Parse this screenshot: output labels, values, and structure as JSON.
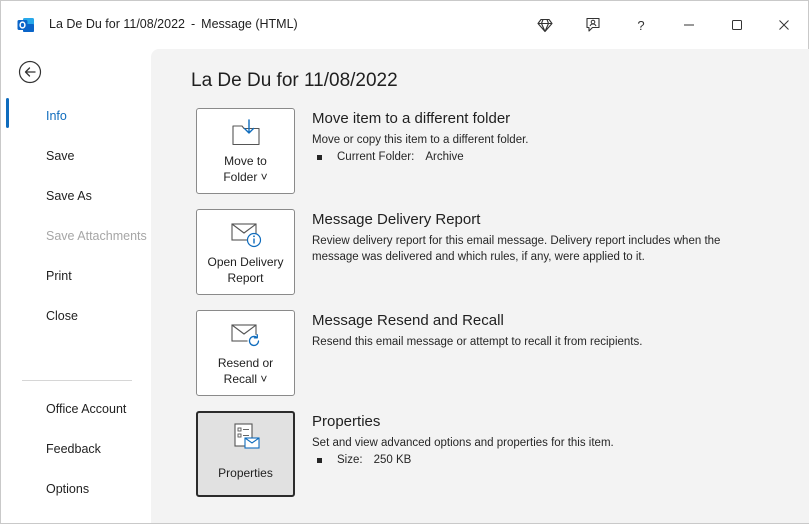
{
  "window": {
    "title_subject": "La De Du for 11/08/2022",
    "title_separator": "-",
    "title_kind": "Message (HTML)",
    "controls": [
      "diamond-icon",
      "feedback-icon",
      "help-icon",
      "minimize-icon",
      "maximize-icon",
      "close-icon"
    ],
    "help_label": "?"
  },
  "sidebar": {
    "items": [
      {
        "label": "Info",
        "state": "active"
      },
      {
        "label": "Save",
        "state": "normal"
      },
      {
        "label": "Save As",
        "state": "normal"
      },
      {
        "label": "Save Attachments",
        "state": "disabled"
      },
      {
        "label": "Print",
        "state": "normal"
      },
      {
        "label": "Close",
        "state": "normal"
      }
    ],
    "bottom_items": [
      {
        "label": "Office Account"
      },
      {
        "label": "Feedback"
      },
      {
        "label": "Options"
      }
    ]
  },
  "main": {
    "title": "La De Du for 11/08/2022",
    "sections": [
      {
        "button_line1": "Move to",
        "button_line2": "Folder ˅",
        "title": "Move item to a different folder",
        "description": "Move or copy this item to a different folder.",
        "detail_label": "Current Folder:",
        "detail_value": "Archive"
      },
      {
        "button_line1": "Open Delivery",
        "button_line2": "Report",
        "title": "Message Delivery Report",
        "description": "Review delivery report for this email message. Delivery report includes when the message was delivered and which rules, if any, were applied to it."
      },
      {
        "button_line1": "Resend or",
        "button_line2": "Recall ˅",
        "title": "Message Resend and Recall",
        "description": "Resend this email message or attempt to recall it from recipients."
      },
      {
        "button_line1": "Properties",
        "title": "Properties",
        "description": "Set and view advanced options and properties for this item.",
        "detail_label": "Size:",
        "detail_value": "250 KB"
      }
    ]
  },
  "colors": {
    "accent": "#0f6cbd",
    "outlook_blue": "#0a64c8",
    "main_bg": "#f3f3f3"
  }
}
